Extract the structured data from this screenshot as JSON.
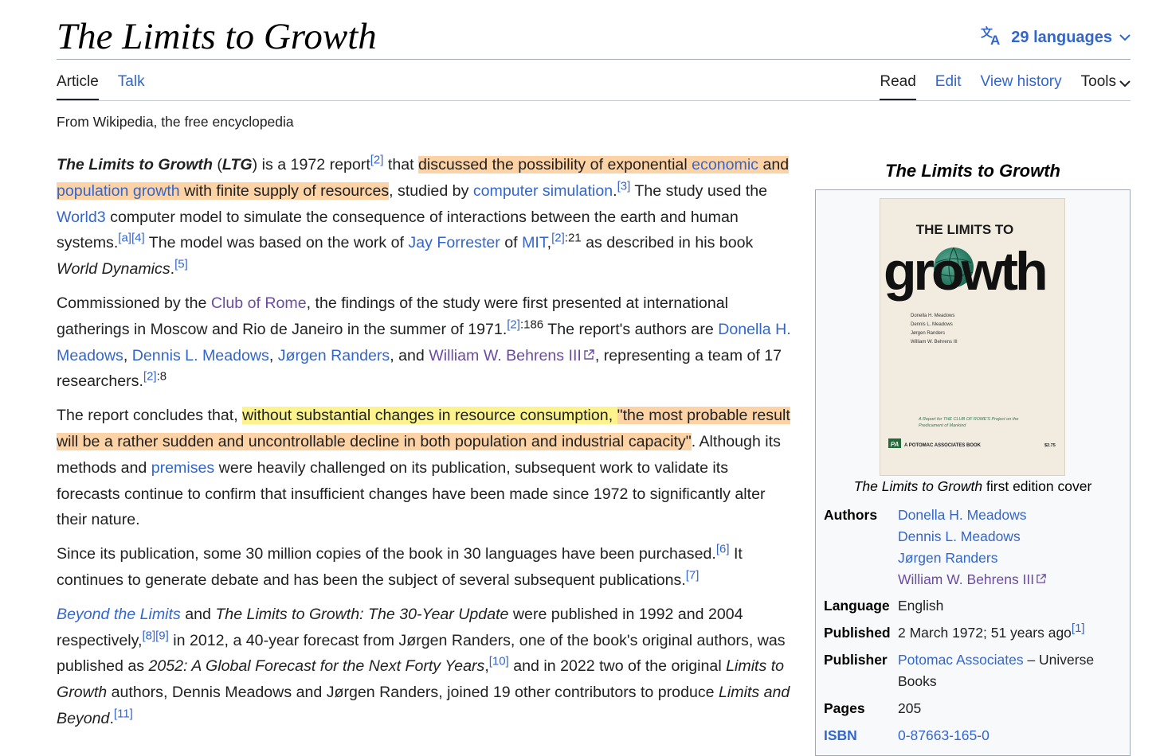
{
  "header": {
    "title": "The Limits to Growth",
    "languages_label": "29 languages"
  },
  "tabs_left": [
    "Article",
    "Talk"
  ],
  "tabs_right": [
    "Read",
    "Edit",
    "View history",
    "Tools"
  ],
  "tagline": "From Wikipedia, the free encyclopedia",
  "paragraphs": {
    "p1": {
      "title_bold": "The Limits to Growth",
      "t1": " (",
      "abbr": "LTG",
      "t2": ") is a 1972 report",
      "ref1": "[2]",
      "t3": " that ",
      "hl1": "discussed the possibility of exponential ",
      "link_economic": "economic",
      "hl_and": "and ",
      "link_population": "population growth",
      "hl2": " with finite supply of resources",
      "t4": ", studied by ",
      "link_computer_sim": "computer simulation",
      "t5": ".",
      "ref2": "[3]",
      "t6": " The study used the ",
      "link_world3": "World3",
      "t7": " computer model to simulate the consequence of interactions between the earth and human systems.",
      "ref3": "[a]",
      "ref4": "[4]",
      "t8": " The model was based on the work of ",
      "link_forrester": "Jay Forrester",
      "t9": " of ",
      "link_mit": "MIT",
      "t10": ",",
      "ref5": "[2]",
      "ref5_page": ":21",
      "t11": " as described in his book ",
      "book": "World Dynamics",
      "t12": ".",
      "ref6": "[5]"
    },
    "p2": {
      "t1": "Commissioned by the ",
      "link_club": "Club of Rome",
      "t2": ", the findings of the study were first presented at international gatherings in Moscow and Rio de Janeiro in the summer of 1971.",
      "ref1": "[2]",
      "ref1_page": ":186",
      "t3": " The report's authors are ",
      "link_a1": "Donella H. Meadows",
      "sep1": ", ",
      "link_a2": "Dennis L. Meadows",
      "sep2": ", ",
      "link_a3": "Jørgen Randers",
      "sep3": ", and ",
      "link_a4": "William W. Behrens III",
      "t4": ", representing a team of 17 researchers.",
      "ref2": "[2]",
      "ref2_page": ":8"
    },
    "p3": {
      "t1": "The report concludes that, ",
      "hl_y": "without substantial changes in resource consumption, ",
      "hl_o": "\"the most probable result will be a rather sudden and uncontrollable decline in both population and industrial capacity\"",
      "t2": ". Although its methods and ",
      "link_premises": "premises",
      "t3": " were heavily challenged on its publication, subsequent work to validate its forecasts continue to confirm that insufficient changes have been made since 1972 to significantly alter their nature."
    },
    "p4": {
      "t1": "Since its publication, some 30 million copies of the book in 30 languages have been purchased.",
      "ref1": "[6]",
      "t2": " It continues to generate debate and has been the subject of several subsequent publications.",
      "ref2": "[7]"
    },
    "p5": {
      "link_beyond": "Beyond the Limits",
      "t1": " and ",
      "book_30yr": "The Limits to Growth: The 30-Year Update",
      "t2": " were published in 1992 and 2004 respectively,",
      "ref1": "[8]",
      "ref2": "[9]",
      "t3": " in 2012, a 40-year forecast from Jørgen Randers, one of the book's original authors, was published as ",
      "book_2052": "2052: A Global Forecast for the Next Forty Years",
      "t4": ",",
      "ref3": "[10]",
      "t5": " and in 2022 two of the original ",
      "book_ltg": "Limits to Growth",
      "t6": " authors, Dennis Meadows and Jørgen Randers, joined 19 other contributors to produce ",
      "book_beyond": "Limits and Beyond",
      "t7": ".",
      "ref4": "[11]"
    }
  },
  "infobox": {
    "caption": "The Limits to Growth",
    "cover_caption_italic": "The Limits to Growth",
    "cover_caption_rest": " first edition cover",
    "cover": {
      "title_top": "THE LIMITS TO",
      "title_big": "growth",
      "authors": [
        "Donella H. Meadows",
        "Dennis L. Meadows",
        "Jørgen Randers",
        "William W. Behrens III"
      ],
      "blurb_line1": "A Report for THE CLUB OF ROME'S Project on the",
      "blurb_line2": "Predicament of Mankind",
      "publisher_logo": "PA",
      "publisher": "A POTOMAC ASSOCIATES BOOK",
      "price": "$2.75"
    },
    "authors_label": "Authors",
    "authors": [
      "Donella H. Meadows",
      "Dennis L. Meadows",
      "Jørgen Randers",
      "William W. Behrens III"
    ],
    "language_label": "Language",
    "language": "English",
    "published_label": "Published",
    "published": "2 March 1972; 51 years ago",
    "published_ref": "[1]",
    "publisher_label": "Publisher",
    "publisher_link": "Potomac Associates",
    "publisher_rest": " – Universe Books",
    "pages_label": "Pages",
    "pages": "205",
    "isbn_label": "ISBN",
    "isbn": "0-87663-165-0"
  }
}
